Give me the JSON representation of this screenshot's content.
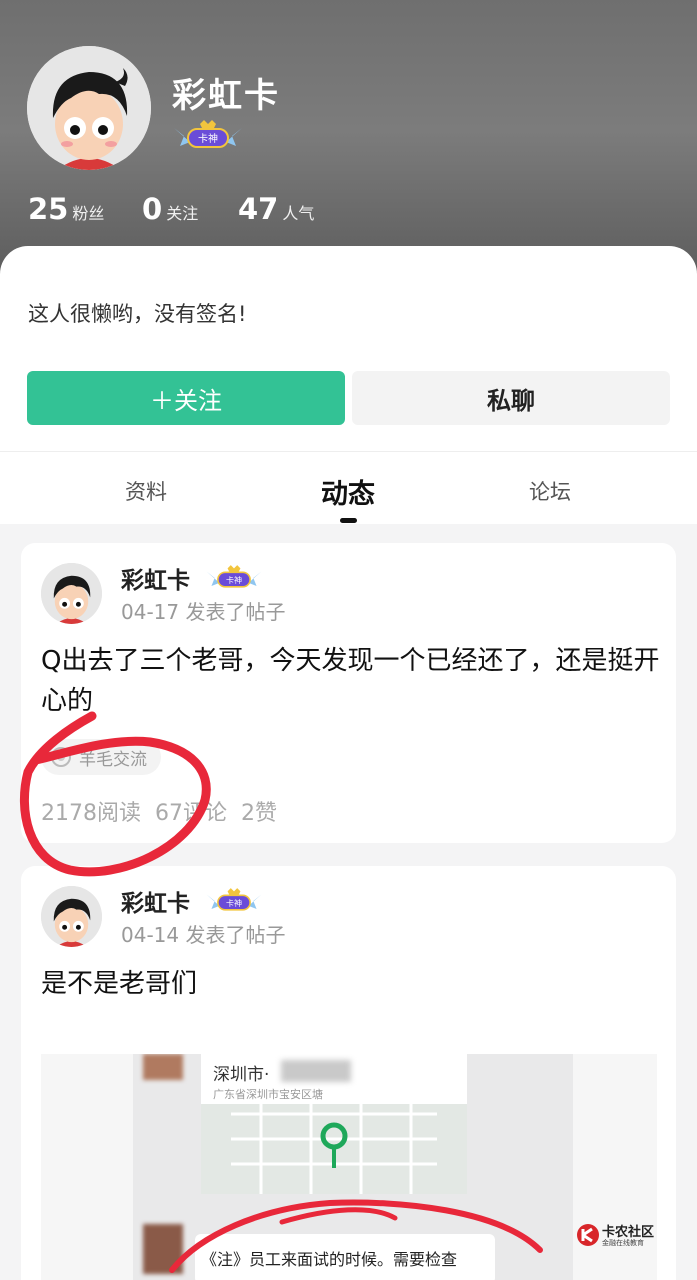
{
  "profile": {
    "username": "彩虹卡",
    "badge_label": "卡神",
    "stats": [
      {
        "num": "25",
        "label": "粉丝"
      },
      {
        "num": "0",
        "label": "关注"
      },
      {
        "num": "47",
        "label": "人气"
      }
    ],
    "signature": "这人很懒哟，没有签名!",
    "follow_label": "＋关注",
    "chat_label": "私聊"
  },
  "tabs": [
    {
      "label": "资料",
      "active": false
    },
    {
      "label": "动态",
      "active": true
    },
    {
      "label": "论坛",
      "active": false
    }
  ],
  "posts": [
    {
      "author": "彩虹卡",
      "badge_label": "卡神",
      "meta": "04-17 发表了帖子",
      "text": "Q出去了三个老哥，今天发现一个已经还了，还是挺开心的",
      "tag": "羊毛交流",
      "reads": "2178阅读",
      "comments": "67评论",
      "likes": "2赞"
    },
    {
      "author": "彩虹卡",
      "badge_label": "卡神",
      "meta": "04-14 发表了帖子",
      "text": "是不是老哥们",
      "image": {
        "map_title": "深圳市·",
        "map_address": "广东省深圳市宝安区塘",
        "message": "《注》员工来面试的时候。需要检查"
      }
    }
  ],
  "watermark": {
    "title": "卡农社区",
    "subtitle": "金融在线教育"
  },
  "colors": {
    "accent": "#33c295",
    "annotation": "#e8283a",
    "badge": "#6a4cd8"
  }
}
